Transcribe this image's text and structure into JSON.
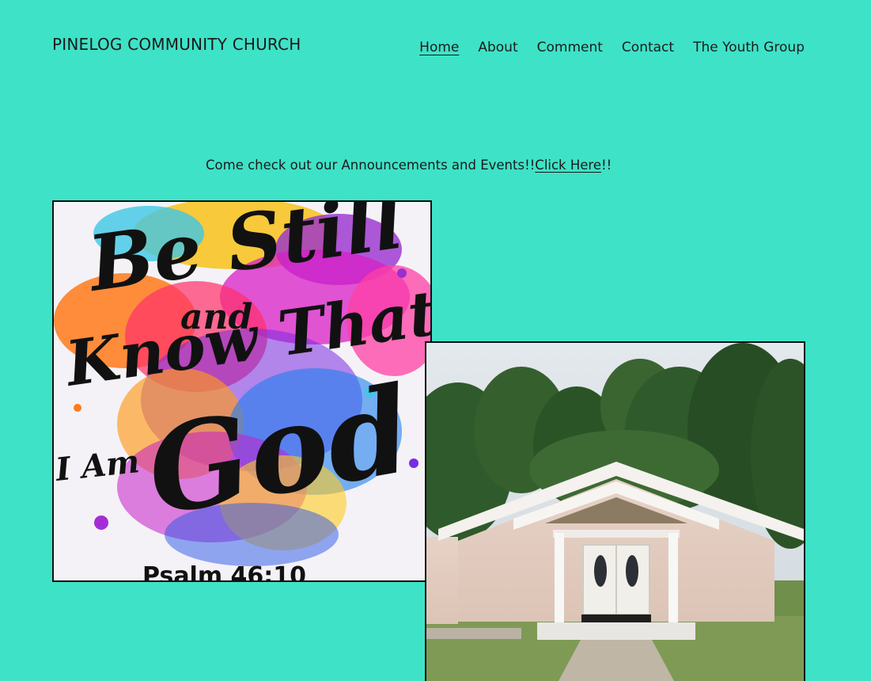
{
  "header": {
    "site_title": "PINELOG COMMUNITY CHURCH",
    "nav": [
      {
        "label": "Home",
        "active": true
      },
      {
        "label": "About",
        "active": false
      },
      {
        "label": "Comment",
        "active": false
      },
      {
        "label": "Contact",
        "active": false
      },
      {
        "label": "The Youth Group",
        "active": false
      }
    ]
  },
  "main": {
    "announcement_prefix": "Come check out our Announcements and Events!!",
    "announcement_link": "Click Here",
    "announcement_suffix": "!!",
    "poster": {
      "line1": "Be Still",
      "line2": "and",
      "line3": "Know That",
      "line4": "I Am",
      "line5": "God",
      "reference": "Psalm 46:10"
    }
  },
  "colors": {
    "background": "#3ee2c7",
    "text": "#1b1b1b"
  }
}
